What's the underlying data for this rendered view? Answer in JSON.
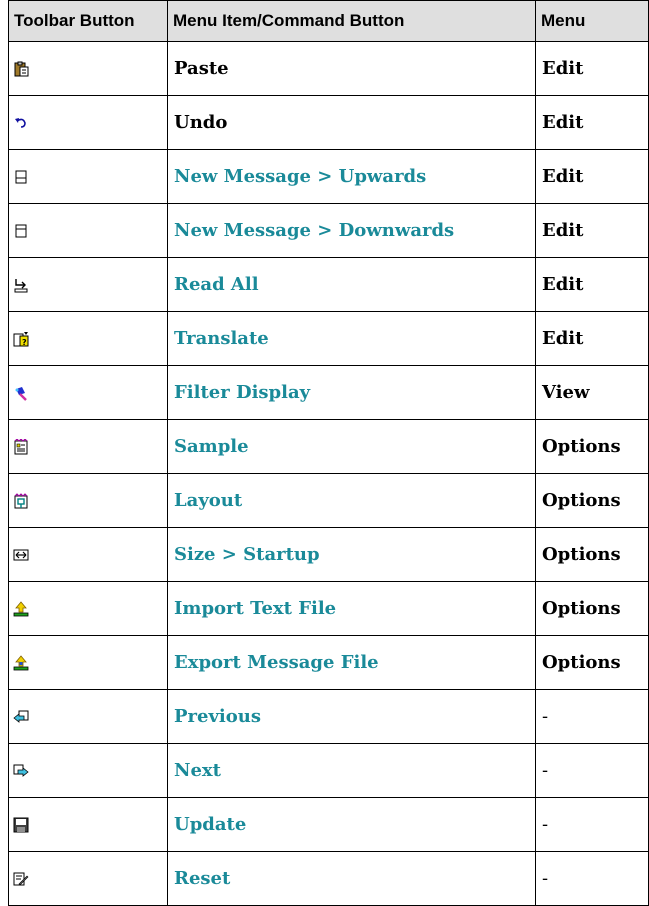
{
  "table": {
    "headers": [
      "Toolbar Button",
      "Menu Item/Command Button",
      "Menu"
    ],
    "rows": [
      {
        "icon": "paste-icon",
        "command": "Paste",
        "menu": "Edit",
        "link": false
      },
      {
        "icon": "undo-icon",
        "command": "Undo",
        "menu": "Edit",
        "link": false
      },
      {
        "icon": "new-message-upwards-icon",
        "command": "New Message > Upwards",
        "menu": "Edit",
        "link": true
      },
      {
        "icon": "new-message-downwards-icon",
        "command": "New Message > Downwards",
        "menu": "Edit",
        "link": true
      },
      {
        "icon": "read-all-icon",
        "command": "Read All",
        "menu": "Edit",
        "link": true
      },
      {
        "icon": "translate-icon",
        "command": "Translate",
        "menu": "Edit",
        "link": true
      },
      {
        "icon": "filter-display-icon",
        "command": "Filter Display",
        "menu": "View",
        "link": true
      },
      {
        "icon": "sample-icon",
        "command": "Sample",
        "menu": "Options",
        "link": true
      },
      {
        "icon": "layout-icon",
        "command": "Layout",
        "menu": "Options",
        "link": true
      },
      {
        "icon": "size-startup-icon",
        "command": "Size > Startup",
        "menu": "Options",
        "link": true
      },
      {
        "icon": "import-text-file-icon",
        "command": "Import Text File",
        "menu": "Options",
        "link": true
      },
      {
        "icon": "export-message-file-icon",
        "command": "Export Message File",
        "menu": "Options",
        "link": true
      },
      {
        "icon": "previous-icon",
        "command": "Previous",
        "menu": "-",
        "link": true
      },
      {
        "icon": "next-icon",
        "command": "Next",
        "menu": "-",
        "link": true
      },
      {
        "icon": "update-icon",
        "command": "Update",
        "menu": "-",
        "link": true
      },
      {
        "icon": "reset-icon",
        "command": "Reset",
        "menu": "-",
        "link": true
      }
    ]
  },
  "colors": {
    "link": "#1a8a99",
    "header_bg": "#dfdfdf",
    "border": "#000000"
  }
}
